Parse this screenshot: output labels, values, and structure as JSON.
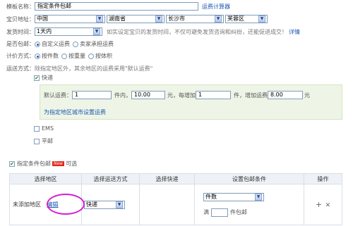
{
  "template_name": {
    "label": "模板名称：",
    "value": "指定条件包邮",
    "calc_link": "运费计算器"
  },
  "address": {
    "label": "宝贝地址：",
    "country": "中国",
    "province": "湖南省",
    "city": "长沙市",
    "district": "芙蓉区"
  },
  "ship_time": {
    "label": "发货时间：",
    "value": "1天内",
    "hint": "如实设定宝贝的发货时间，不仅可避免发货咨询和纠纷，还能促进成交！",
    "detail_link": "详情"
  },
  "free_ship": {
    "label": "是否包邮：",
    "options": [
      "自定义运费",
      "卖家承担运费"
    ],
    "selected": 0
  },
  "pricing": {
    "label": "计价方式：",
    "options": [
      "按件数",
      "按重量",
      "按体积"
    ],
    "selected": 0
  },
  "shipping_mode": {
    "label": "运送方式：",
    "hint": "除指定地区外，其余地区的运费采用\"默认运费\""
  },
  "express": {
    "label": "快递",
    "checked": true
  },
  "default_fee": {
    "label": "默认运费：",
    "first_qty": "1",
    "unit_qty": "件内，",
    "first_fee": "10.00",
    "unit_fee": "元，每增加",
    "add_qty": "1",
    "unit_add": "件，增加运费",
    "add_fee": "8.00",
    "unit_yuan": "元"
  },
  "city_link": "为指定地区城市设置运费",
  "ems": {
    "label": "EMS",
    "checked": false
  },
  "ping": {
    "label": "平邮",
    "checked": false
  },
  "conditional": {
    "label": "指定条件包邮",
    "badge": "New",
    "suffix": "可选",
    "checked": true
  },
  "table": {
    "headers": [
      "选择地区",
      "选择运送方式",
      "选择快递",
      "设置包邮条件",
      "操作"
    ],
    "row": {
      "area": "未添加地区",
      "edit": "编辑",
      "mode": "快递",
      "condition": "件数",
      "full_prefix": "满",
      "full_suffix": "件包邮"
    }
  },
  "colors": {
    "link": "#1b57b0",
    "highlight": "#d41ed1",
    "panel_bg": "#eef5e6"
  }
}
